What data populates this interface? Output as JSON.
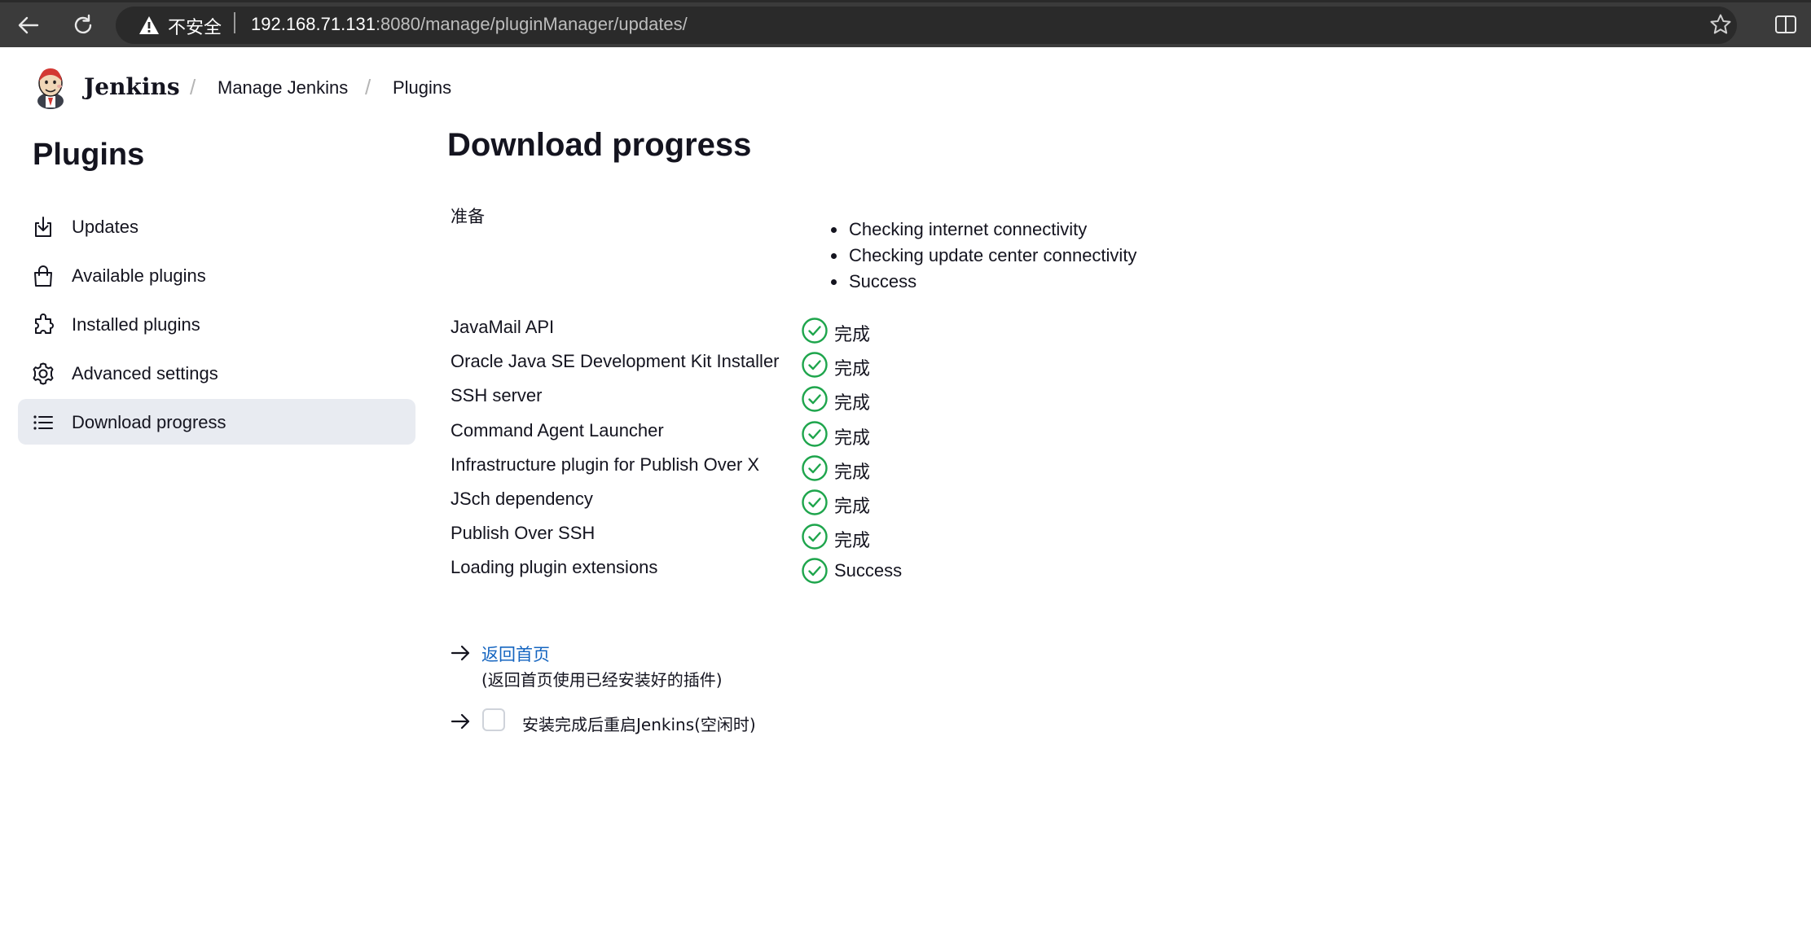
{
  "browser": {
    "security_label": "不安全",
    "url_host": "192.168.71.131",
    "url_rest": ":8080/manage/pluginManager/updates/"
  },
  "header": {
    "brand": "Jenkins",
    "breadcrumbs": [
      {
        "label": "Manage Jenkins"
      },
      {
        "label": "Plugins"
      }
    ]
  },
  "sidebar": {
    "title": "Plugins",
    "items": [
      {
        "label": "Updates",
        "icon": "download-icon"
      },
      {
        "label": "Available plugins",
        "icon": "shopping-bag-icon"
      },
      {
        "label": "Installed plugins",
        "icon": "puzzle-icon"
      },
      {
        "label": "Advanced settings",
        "icon": "gear-icon"
      },
      {
        "label": "Download progress",
        "icon": "list-icon",
        "active": true
      }
    ]
  },
  "main": {
    "title": "Download progress",
    "preparation": {
      "label": "准备",
      "steps": [
        "Checking internet connectivity",
        "Checking update center connectivity",
        "Success"
      ]
    },
    "plugins": [
      {
        "name": "JavaMail API",
        "status": "完成"
      },
      {
        "name": "Oracle Java SE Development Kit Installer",
        "status": "完成"
      },
      {
        "name": "SSH server",
        "status": "完成"
      },
      {
        "name": "Command Agent Launcher",
        "status": "完成"
      },
      {
        "name": "Infrastructure plugin for Publish Over X",
        "status": "完成"
      },
      {
        "name": "JSch dependency",
        "status": "完成"
      },
      {
        "name": "Publish Over SSH",
        "status": "完成"
      },
      {
        "name": "Loading plugin extensions",
        "status": "Success"
      }
    ],
    "go_back_link": "返回首页",
    "go_back_description": "(返回首页使用已经安装好的插件)",
    "restart_label": "安装完成后重启Jenkins(空闲时)",
    "restart_checked": false
  },
  "colors": {
    "success": "#1ea54c",
    "link": "#1565c0",
    "active_item_bg": "#e8ebf1"
  }
}
